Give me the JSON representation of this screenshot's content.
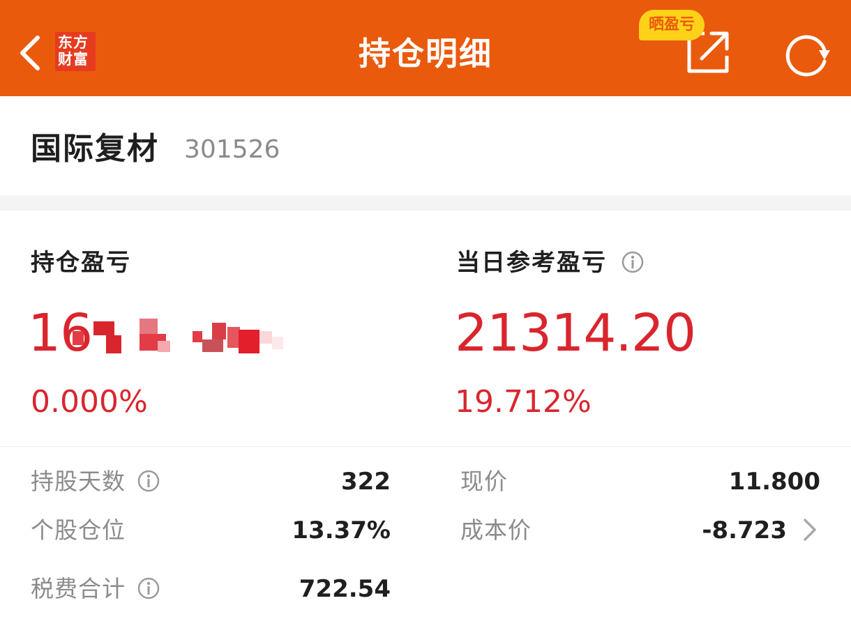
{
  "header": {
    "title": "持仓明细",
    "logo_line1": "东方",
    "logo_line2": "财富",
    "share_badge": "晒盈亏",
    "accent_color": "#ea5a0c",
    "badge_color": "#ffd21a"
  },
  "stock": {
    "name": "国际复材",
    "code": "301526"
  },
  "pnl": {
    "holding_label": "持仓盈亏",
    "holding_value_visible": "16",
    "holding_pct": "0.000%",
    "today_label": "当日参考盈亏",
    "today_value": "21314.20",
    "today_pct": "19.712%",
    "up_color": "#d9262e"
  },
  "details": {
    "days_label": "持股天数",
    "days_value": "322",
    "position_label": "个股仓位",
    "position_value": "13.37%",
    "fee_label": "税费合计",
    "fee_value": "722.54",
    "price_label": "现价",
    "price_value": "11.800",
    "cost_label": "成本价",
    "cost_value": "-8.723"
  },
  "icons": {
    "back": "back-arrow-icon",
    "share": "share-icon",
    "refresh": "refresh-icon",
    "info": "info-icon",
    "chevron": "chevron-right-icon"
  }
}
